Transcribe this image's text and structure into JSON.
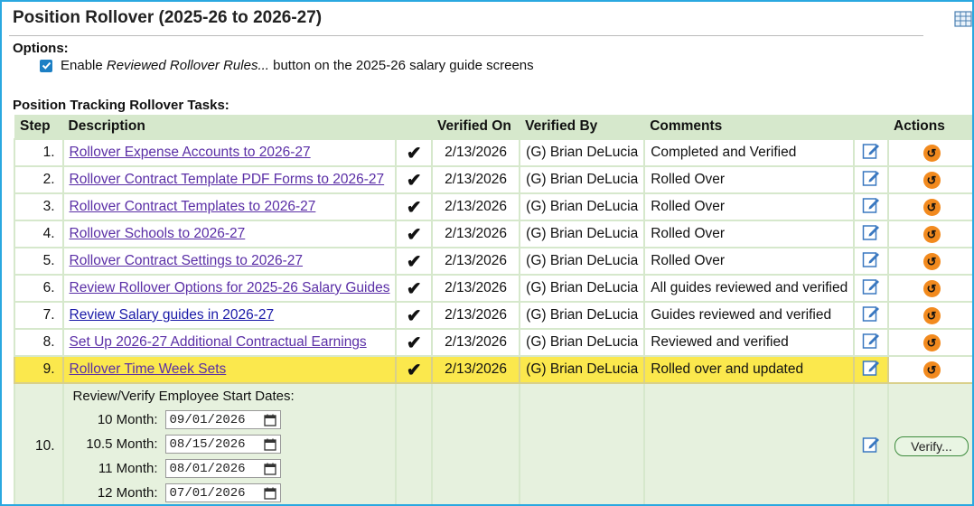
{
  "header": {
    "title": "Position Rollover (2025-26 to 2026-27)"
  },
  "options": {
    "label": "Options:",
    "enable_text_prefix": "Enable ",
    "enable_text_italic": "Reviewed Rollover Rules...",
    "enable_text_suffix": " button on the 2025-26 salary guide screens",
    "checked": true
  },
  "tasks_label": "Position Tracking Rollover Tasks:",
  "table": {
    "headers": {
      "step": "Step",
      "description": "Description",
      "verified_on": "Verified On",
      "verified_by": "Verified By",
      "comments": "Comments",
      "actions": "Actions"
    },
    "rows": [
      {
        "step": "1.",
        "description": "Rollover Expense Accounts to 2026-27",
        "check": "✔",
        "verified_on": "2/13/2026",
        "verified_by": "(G) Brian DeLucia",
        "comments": "Completed and Verified"
      },
      {
        "step": "2.",
        "description": "Rollover Contract Template PDF Forms to 2026-27",
        "check": "✔",
        "verified_on": "2/13/2026",
        "verified_by": "(G) Brian DeLucia",
        "comments": "Rolled Over"
      },
      {
        "step": "3.",
        "description": "Rollover Contract Templates to 2026-27",
        "check": "✔",
        "verified_on": "2/13/2026",
        "verified_by": "(G) Brian DeLucia",
        "comments": "Rolled Over"
      },
      {
        "step": "4.",
        "description": "Rollover Schools to 2026-27",
        "check": "✔",
        "verified_on": "2/13/2026",
        "verified_by": "(G) Brian DeLucia",
        "comments": "Rolled Over"
      },
      {
        "step": "5.",
        "description": "Rollover Contract Settings to 2026-27",
        "check": "✔",
        "verified_on": "2/13/2026",
        "verified_by": "(G) Brian DeLucia",
        "comments": "Rolled Over"
      },
      {
        "step": "6.",
        "description": "Review Rollover Options for 2025-26 Salary Guides",
        "check": "✔",
        "verified_on": "2/13/2026",
        "verified_by": "(G) Brian DeLucia",
        "comments": "All guides reviewed and verified"
      },
      {
        "step": "7.",
        "description": "Review Salary guides in 2026-27",
        "check": "✔",
        "verified_on": "2/13/2026",
        "verified_by": "(G) Brian DeLucia",
        "comments": "Guides reviewed and verified"
      },
      {
        "step": "8.",
        "description": "Set Up 2026-27 Additional Contractual Earnings",
        "check": "✔",
        "verified_on": "2/13/2026",
        "verified_by": "(G) Brian DeLucia",
        "comments": "Reviewed and verified"
      },
      {
        "step": "9.",
        "description": "Rollover Time Week Sets",
        "check": "✔",
        "verified_on": "2/13/2026",
        "verified_by": "(G) Brian DeLucia",
        "comments": "Rolled over and updated"
      }
    ],
    "last_row": {
      "step": "10.",
      "title": "Review/Verify Employee Start Dates:",
      "dates": [
        {
          "label": "10 Month:",
          "value": "09/01/2026"
        },
        {
          "label": "10.5 Month:",
          "value": "08/15/2026"
        },
        {
          "label": "11 Month:",
          "value": "08/01/2026"
        },
        {
          "label": "12 Month:",
          "value": "07/01/2026"
        }
      ],
      "verify_label": "Verify..."
    }
  },
  "colors": {
    "border": "#2aa8e0",
    "header_bg": "#d6e8cc",
    "highlight": "#fbe84d",
    "undo": "#f28a1e",
    "link": "#5a2ea6"
  },
  "icons": {
    "edit": "edit-icon",
    "undo": "undo-icon",
    "calendar": "calendar-icon",
    "grid": "grid-icon",
    "check": "check-icon"
  }
}
